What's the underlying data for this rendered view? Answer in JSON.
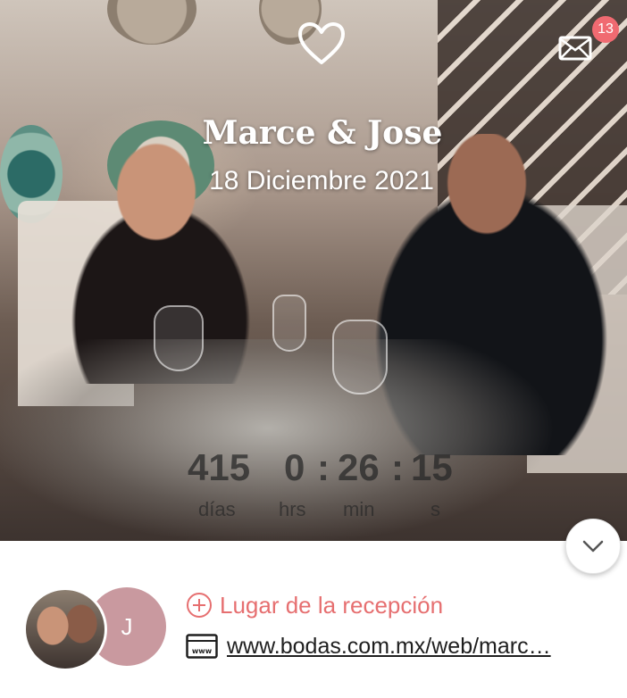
{
  "header": {
    "couple_names": "Marce & Jose",
    "wedding_date": "18 Diciembre 2021",
    "notifications_count": "13",
    "icons": {
      "heart": "heart-outline-icon",
      "mail": "envelope-icon"
    }
  },
  "countdown": {
    "days": "415",
    "days_label": "días",
    "hours": "0",
    "hours_label": "hrs",
    "minutes": "26",
    "minutes_label": "min",
    "seconds": "15",
    "seconds_label": "s",
    "separator": ":"
  },
  "expand": {
    "icon": "chevron-down-icon"
  },
  "profile": {
    "initial": "J",
    "reception_label": "Lugar de la recepción",
    "website_text": "www.bodas.com.mx/web/marc…"
  },
  "colors": {
    "accent": "#e66f70",
    "badge": "#f06a71",
    "avatar_initial_bg": "#c9999f"
  }
}
